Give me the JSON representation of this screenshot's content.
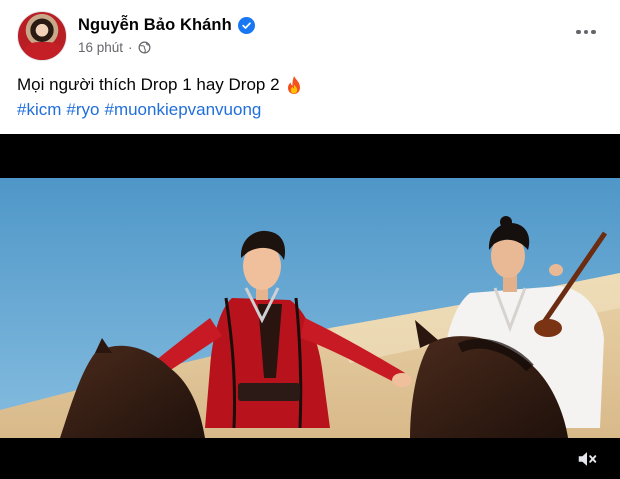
{
  "post": {
    "author": "Nguyễn Bảo Khánh",
    "time": "16 phút",
    "separator": "·",
    "caption": "Mọi người thích Drop 1 hay Drop 2",
    "hashtags": [
      "#kicm",
      "#ryo",
      "#muonkiepvanvuong"
    ]
  },
  "icons": {
    "verified": "verified-badge-icon",
    "audience": "globe-icon",
    "emoji": "fire-icon",
    "more": "more-options-icon",
    "sound": "muted-speaker-icon"
  },
  "colors": {
    "brand_blue": "#1877f2",
    "hashtag": "#216fdb",
    "meta_text": "#65676b",
    "sky": "#5da2cf",
    "costume_red": "#c81a24"
  }
}
